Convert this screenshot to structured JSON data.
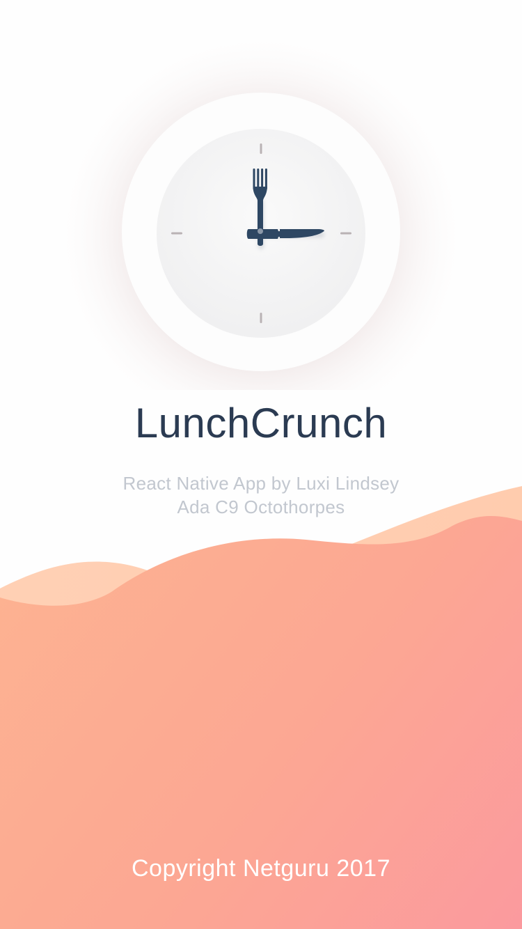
{
  "app": {
    "title": "LunchCrunch",
    "subtitle_line1": "React Native App by Luxi Lindsey",
    "subtitle_line2": "Ada C9 Octothorpes",
    "copyright": "Copyright Netguru 2017"
  },
  "logo": {
    "icon": "clock-icon",
    "hands": [
      "fork-icon",
      "knife-icon"
    ]
  },
  "colors": {
    "title": "#2b3b52",
    "subtitle": "#c2c7cf",
    "wave_start": "#fdb391",
    "wave_end": "#fb9a9e",
    "hands": "#2e4763"
  }
}
